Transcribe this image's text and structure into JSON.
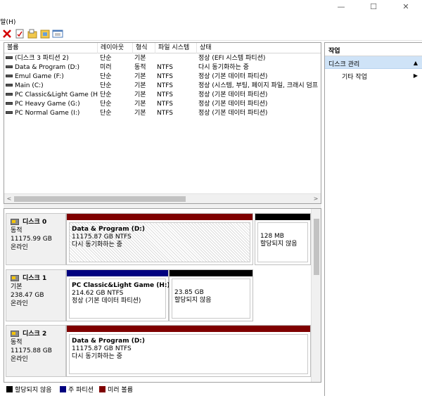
{
  "window": {
    "minimize_glyph": "—",
    "maximize_glyph": "☐",
    "close_glyph": "✕"
  },
  "menu": {
    "help": "움말(H)"
  },
  "toolbar": {
    "icons": [
      "delete-icon",
      "check-icon",
      "folder-icon",
      "properties-icon",
      "view-icon"
    ]
  },
  "volume_list": {
    "columns": [
      "볼륨",
      "레이아웃",
      "형식",
      "파일 시스템",
      "상태"
    ],
    "rows": [
      {
        "volume": "(디스크 3 파티션 2)",
        "layout": "단순",
        "type": "기본",
        "fs": "",
        "status": "정상 (EFI 시스템 파티션)"
      },
      {
        "volume": "Data & Program (D:)",
        "layout": "미러",
        "type": "동적",
        "fs": "NTFS",
        "status": "다시 동기화하는 중"
      },
      {
        "volume": "Emul Game (F:)",
        "layout": "단순",
        "type": "기본",
        "fs": "NTFS",
        "status": "정상 (기본 데이터 파티션)"
      },
      {
        "volume": "Main (C:)",
        "layout": "단순",
        "type": "기본",
        "fs": "NTFS",
        "status": "정상 (시스템, 부팅, 페이지 파일, 크래시 덤프"
      },
      {
        "volume": "PC Classic&Light Game (H:)",
        "layout": "단순",
        "type": "기본",
        "fs": "NTFS",
        "status": "정상 (기본 데이터 파티션)"
      },
      {
        "volume": "PC Heavy Game (G:)",
        "layout": "단순",
        "type": "기본",
        "fs": "NTFS",
        "status": "정상 (기본 데이터 파티션)"
      },
      {
        "volume": "PC Normal Game (I:)",
        "layout": "단순",
        "type": "기본",
        "fs": "NTFS",
        "status": "정상 (기본 데이터 파티션)"
      }
    ]
  },
  "disks": [
    {
      "name": "디스크 0",
      "kind": "동적",
      "size": "11175.99 GB",
      "state": "온라인",
      "partitions": [
        {
          "title": "Data & Program  (D:)",
          "line2": "11175.87 GB NTFS",
          "line3": "다시 동기화하는 중"
        },
        {
          "title": "",
          "line2": "128 MB",
          "line3": "할당되지 않음"
        }
      ]
    },
    {
      "name": "디스크 1",
      "kind": "기본",
      "size": "238.47 GB",
      "state": "온라인",
      "partitions": [
        {
          "title": "PC Classic&Light Game  (H:)",
          "line2": "214.62 GB NTFS",
          "line3": "정상 (기본 데이터 파티션)"
        },
        {
          "title": "",
          "line2": "23.85 GB",
          "line3": "할당되지 않음"
        }
      ]
    },
    {
      "name": "디스크 2",
      "kind": "동적",
      "size": "11175.88 GB",
      "state": "온라인",
      "partitions": [
        {
          "title": "Data & Program  (D:)",
          "line2": "11175.87 GB NTFS",
          "line3": "다시 동기화하는 중"
        }
      ]
    }
  ],
  "legend": [
    {
      "label": "할당되지 않음",
      "color": "#000000"
    },
    {
      "label": "주 파티션",
      "color": "#00007f"
    },
    {
      "label": "미러 볼륨",
      "color": "#7f0000"
    }
  ],
  "actions": {
    "header": "작업",
    "selected": "디스크 관리",
    "more": "기타 작업"
  }
}
